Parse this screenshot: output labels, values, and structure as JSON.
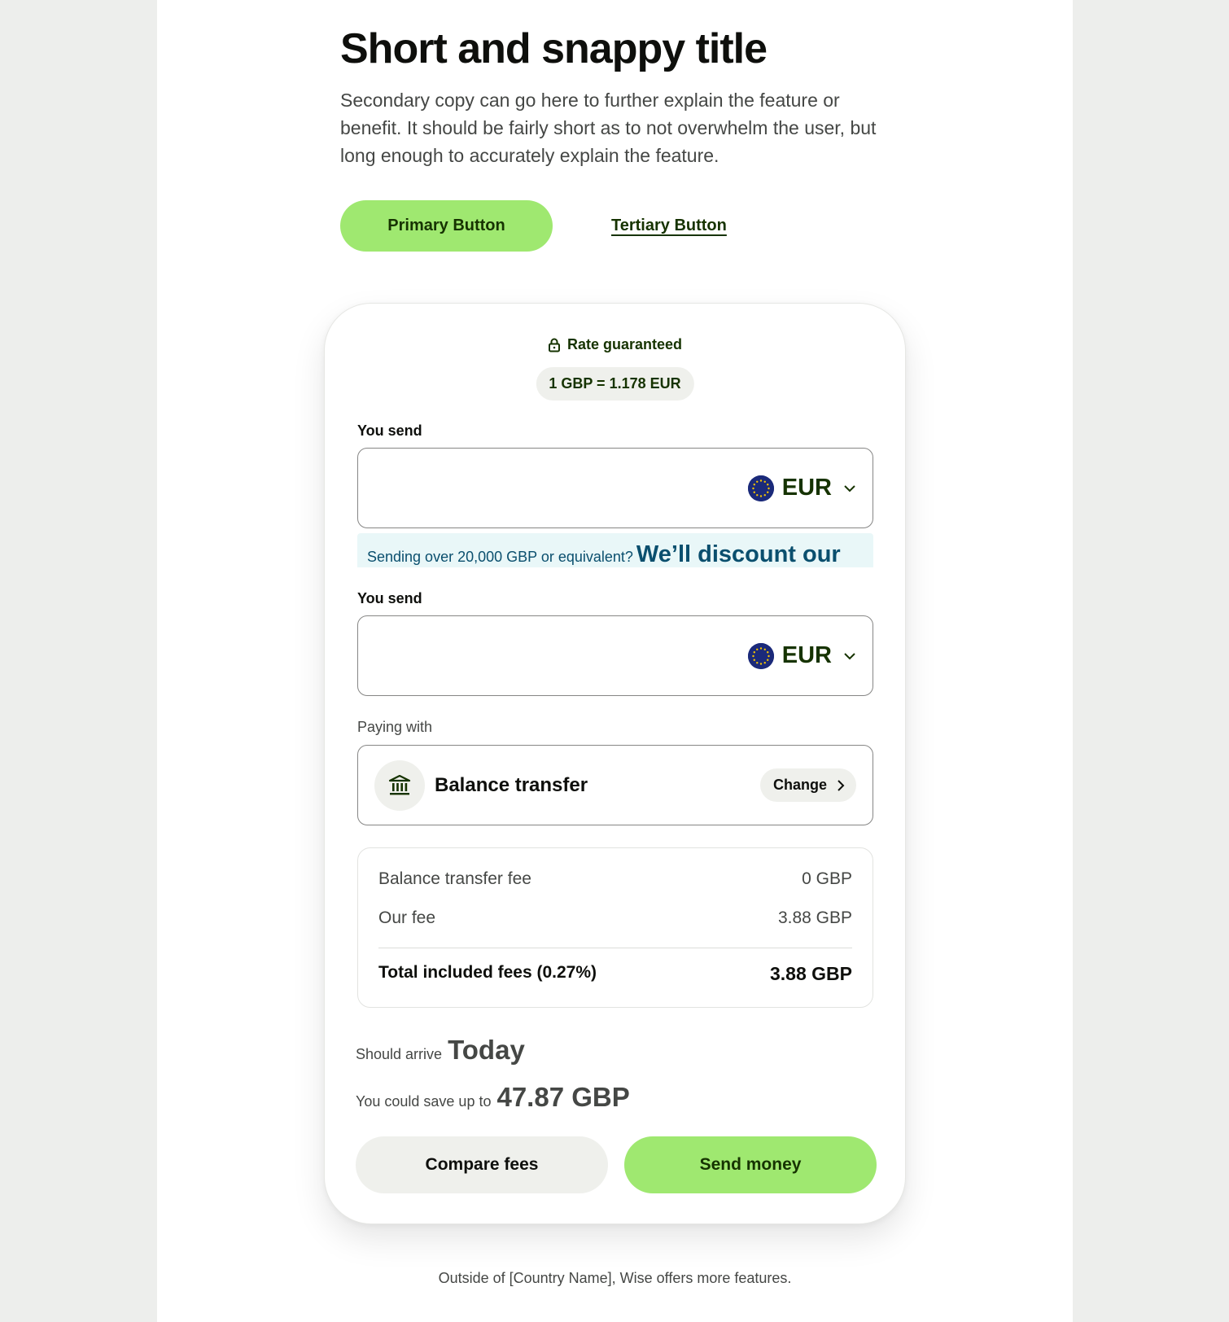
{
  "hero": {
    "title": "Short and snappy title",
    "body": "Secondary copy can go here to further explain the feature or benefit. It should be fairly short as to not overwhelm the user, but long enough to accurately explain the feature.",
    "primary_button": "Primary Button",
    "tertiary_button": "Tertiary Button"
  },
  "calculator": {
    "rate_guaranteed": "Rate guaranteed",
    "rate": "1 GBP = 1.178 EUR",
    "send_1": {
      "label": "You send",
      "amount": "",
      "currency": "EUR"
    },
    "banner": {
      "small": "Sending over 20,000 GBP or equivalent?",
      "big": "We’ll discount our"
    },
    "send_2": {
      "label": "You send",
      "amount": "",
      "currency": "EUR"
    },
    "paying_with": {
      "label": "Paying with",
      "method": "Balance transfer",
      "change_label": "Change"
    },
    "fees": {
      "rows": [
        {
          "label": "Balance transfer fee",
          "value": "0 GBP"
        },
        {
          "label": "Our fee",
          "value": "3.88 GBP"
        }
      ],
      "total_label": "Total included fees (0.27%)",
      "total_value": "3.88 GBP"
    },
    "arrival": {
      "prefix": "Should arrive",
      "value": "Today"
    },
    "savings": {
      "prefix": "You could save up to",
      "value": "47.87 GBP"
    },
    "compare_button": "Compare fees",
    "send_button": "Send money"
  },
  "footer": {
    "note": "Outside of [Country Name], Wise offers more features."
  },
  "colors": {
    "brand_green": "#9fe870",
    "forest_green": "#163300",
    "neutral_bg": "#eff0ec",
    "banner_bg": "#e9f7f8",
    "banner_text": "#0a4f6e"
  },
  "icons": {
    "lock": "lock-icon",
    "flag": "eu-flag-icon",
    "chevron": "chevron-down-icon",
    "bank": "bank-icon",
    "chevron_right": "chevron-right-icon"
  }
}
